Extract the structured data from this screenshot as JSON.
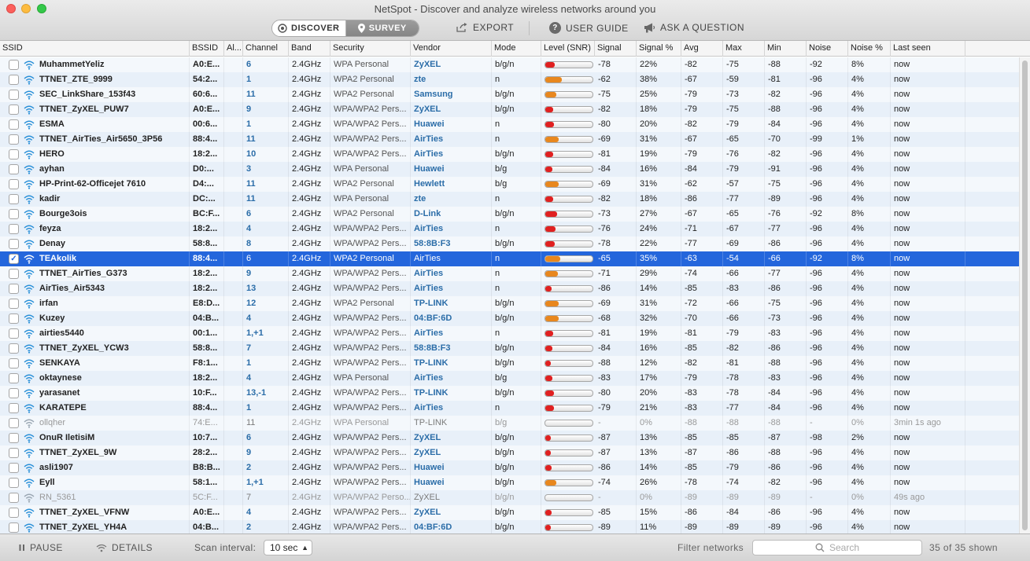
{
  "window": {
    "title": "NetSpot - Discover and analyze wireless networks around you"
  },
  "toolbar": {
    "discover_label": "DISCOVER",
    "survey_label": "SURVEY",
    "export_label": "EXPORT",
    "user_guide_label": "USER GUIDE",
    "ask_label": "ASK A QUESTION"
  },
  "columns": {
    "ssid": "SSID",
    "bssid": "BSSID",
    "alias": "Al...",
    "channel": "Channel",
    "band": "Band",
    "security": "Security",
    "vendor": "Vendor",
    "mode": "Mode",
    "level": "Level (SNR)",
    "signal": "Signal",
    "signal_pct": "Signal %",
    "avg": "Avg",
    "max": "Max",
    "min": "Min",
    "noise": "Noise",
    "noise_pct": "Noise %",
    "last_seen": "Last seen"
  },
  "colors": {
    "level_red": "#e02020",
    "level_orange": "#e8871e",
    "selection": "#2466dc",
    "link": "#2b6da8"
  },
  "rows": [
    {
      "ssid": "MuhammetYeliz",
      "bssid": "A0:E...",
      "channel": "6",
      "band": "2.4GHz",
      "security": "WPA Personal",
      "vendor": "ZyXEL",
      "mode": "b/g/n",
      "signal": "-78",
      "signal_pct": "22%",
      "level": 22,
      "level_color": "red",
      "avg": "-82",
      "max": "-75",
      "min": "-88",
      "noise": "-92",
      "noise_pct": "8%",
      "last_seen": "now"
    },
    {
      "ssid": "TTNET_ZTE_9999",
      "bssid": "54:2...",
      "channel": "1",
      "band": "2.4GHz",
      "security": "WPA2 Personal",
      "vendor": "zte",
      "mode": "n",
      "signal": "-62",
      "signal_pct": "38%",
      "level": 38,
      "level_color": "orange",
      "avg": "-67",
      "max": "-59",
      "min": "-81",
      "noise": "-96",
      "noise_pct": "4%",
      "last_seen": "now"
    },
    {
      "ssid": "SEC_LinkShare_153f43",
      "bssid": "60:6...",
      "channel": "11",
      "band": "2.4GHz",
      "security": "WPA2 Personal",
      "vendor": "Samsung",
      "mode": "b/g/n",
      "signal": "-75",
      "signal_pct": "25%",
      "level": 25,
      "level_color": "orange",
      "avg": "-79",
      "max": "-73",
      "min": "-82",
      "noise": "-96",
      "noise_pct": "4%",
      "last_seen": "now"
    },
    {
      "ssid": "TTNET_ZyXEL_PUW7",
      "bssid": "A0:E...",
      "channel": "9",
      "band": "2.4GHz",
      "security": "WPA/WPA2 Pers...",
      "vendor": "ZyXEL",
      "mode": "b/g/n",
      "signal": "-82",
      "signal_pct": "18%",
      "level": 18,
      "level_color": "red",
      "avg": "-79",
      "max": "-75",
      "min": "-88",
      "noise": "-96",
      "noise_pct": "4%",
      "last_seen": "now"
    },
    {
      "ssid": "ESMA",
      "bssid": "00:6...",
      "channel": "1",
      "band": "2.4GHz",
      "security": "WPA/WPA2 Pers...",
      "vendor": "Huawei",
      "mode": "n",
      "signal": "-80",
      "signal_pct": "20%",
      "level": 20,
      "level_color": "red",
      "avg": "-82",
      "max": "-79",
      "min": "-84",
      "noise": "-96",
      "noise_pct": "4%",
      "last_seen": "now"
    },
    {
      "ssid": "TTNET_AirTies_Air5650_3P56",
      "bssid": "88:4...",
      "channel": "11",
      "band": "2.4GHz",
      "security": "WPA/WPA2 Pers...",
      "vendor": "AirTies",
      "mode": "n",
      "signal": "-69",
      "signal_pct": "31%",
      "level": 31,
      "level_color": "orange",
      "avg": "-67",
      "max": "-65",
      "min": "-70",
      "noise": "-99",
      "noise_pct": "1%",
      "last_seen": "now"
    },
    {
      "ssid": "HERO",
      "bssid": "18:2...",
      "channel": "10",
      "band": "2.4GHz",
      "security": "WPA/WPA2 Pers...",
      "vendor": "AirTies",
      "mode": "b/g/n",
      "signal": "-81",
      "signal_pct": "19%",
      "level": 19,
      "level_color": "red",
      "avg": "-79",
      "max": "-76",
      "min": "-82",
      "noise": "-96",
      "noise_pct": "4%",
      "last_seen": "now"
    },
    {
      "ssid": "ayhan",
      "bssid": "D0:...",
      "channel": "3",
      "band": "2.4GHz",
      "security": "WPA Personal",
      "vendor": "Huawei",
      "mode": "b/g",
      "signal": "-84",
      "signal_pct": "16%",
      "level": 16,
      "level_color": "red",
      "avg": "-84",
      "max": "-79",
      "min": "-91",
      "noise": "-96",
      "noise_pct": "4%",
      "last_seen": "now"
    },
    {
      "ssid": "HP-Print-62-Officejet 7610",
      "bssid": "D4:...",
      "channel": "11",
      "band": "2.4GHz",
      "security": "WPA2 Personal",
      "vendor": "Hewlett",
      "mode": "b/g",
      "signal": "-69",
      "signal_pct": "31%",
      "level": 31,
      "level_color": "orange",
      "avg": "-62",
      "max": "-57",
      "min": "-75",
      "noise": "-96",
      "noise_pct": "4%",
      "last_seen": "now"
    },
    {
      "ssid": "kadir",
      "bssid": "DC:...",
      "channel": "11",
      "band": "2.4GHz",
      "security": "WPA Personal",
      "vendor": "zte",
      "mode": "n",
      "signal": "-82",
      "signal_pct": "18%",
      "level": 18,
      "level_color": "red",
      "avg": "-86",
      "max": "-77",
      "min": "-89",
      "noise": "-96",
      "noise_pct": "4%",
      "last_seen": "now"
    },
    {
      "ssid": "Bourge3ois",
      "bssid": "BC:F...",
      "channel": "6",
      "band": "2.4GHz",
      "security": "WPA2 Personal",
      "vendor": "D-Link",
      "mode": "b/g/n",
      "signal": "-73",
      "signal_pct": "27%",
      "level": 27,
      "level_color": "red",
      "avg": "-67",
      "max": "-65",
      "min": "-76",
      "noise": "-92",
      "noise_pct": "8%",
      "last_seen": "now"
    },
    {
      "ssid": "feyza",
      "bssid": "18:2...",
      "channel": "4",
      "band": "2.4GHz",
      "security": "WPA/WPA2 Pers...",
      "vendor": "AirTies",
      "mode": "n",
      "signal": "-76",
      "signal_pct": "24%",
      "level": 24,
      "level_color": "red",
      "avg": "-71",
      "max": "-67",
      "min": "-77",
      "noise": "-96",
      "noise_pct": "4%",
      "last_seen": "now"
    },
    {
      "ssid": "Denay",
      "bssid": "58:8...",
      "channel": "8",
      "band": "2.4GHz",
      "security": "WPA/WPA2 Pers...",
      "vendor": "58:8B:F3",
      "mode": "b/g/n",
      "signal": "-78",
      "signal_pct": "22%",
      "level": 22,
      "level_color": "red",
      "avg": "-77",
      "max": "-69",
      "min": "-86",
      "noise": "-96",
      "noise_pct": "4%",
      "last_seen": "now"
    },
    {
      "ssid": "TEAkolik",
      "bssid": "88:4...",
      "channel": "6",
      "band": "2.4GHz",
      "security": "WPA2 Personal",
      "vendor": "AirTies",
      "mode": "n",
      "signal": "-65",
      "signal_pct": "35%",
      "level": 35,
      "level_color": "orange",
      "avg": "-63",
      "max": "-54",
      "min": "-66",
      "noise": "-92",
      "noise_pct": "8%",
      "last_seen": "now",
      "selected": true
    },
    {
      "ssid": "TTNET_AirTies_G373",
      "bssid": "18:2...",
      "channel": "9",
      "band": "2.4GHz",
      "security": "WPA/WPA2 Pers...",
      "vendor": "AirTies",
      "mode": "n",
      "signal": "-71",
      "signal_pct": "29%",
      "level": 29,
      "level_color": "orange",
      "avg": "-74",
      "max": "-66",
      "min": "-77",
      "noise": "-96",
      "noise_pct": "4%",
      "last_seen": "now"
    },
    {
      "ssid": "AirTies_Air5343",
      "bssid": "18:2...",
      "channel": "13",
      "band": "2.4GHz",
      "security": "WPA/WPA2 Pers...",
      "vendor": "AirTies",
      "mode": "n",
      "signal": "-86",
      "signal_pct": "14%",
      "level": 14,
      "level_color": "red",
      "avg": "-85",
      "max": "-83",
      "min": "-86",
      "noise": "-96",
      "noise_pct": "4%",
      "last_seen": "now"
    },
    {
      "ssid": "irfan",
      "bssid": "E8:D...",
      "channel": "12",
      "band": "2.4GHz",
      "security": "WPA2 Personal",
      "vendor": "TP-LINK",
      "mode": "b/g/n",
      "signal": "-69",
      "signal_pct": "31%",
      "level": 31,
      "level_color": "orange",
      "avg": "-72",
      "max": "-66",
      "min": "-75",
      "noise": "-96",
      "noise_pct": "4%",
      "last_seen": "now"
    },
    {
      "ssid": "Kuzey",
      "bssid": "04:B...",
      "channel": "4",
      "band": "2.4GHz",
      "security": "WPA/WPA2 Pers...",
      "vendor": "04:BF:6D",
      "mode": "b/g/n",
      "signal": "-68",
      "signal_pct": "32%",
      "level": 32,
      "level_color": "orange",
      "avg": "-70",
      "max": "-66",
      "min": "-73",
      "noise": "-96",
      "noise_pct": "4%",
      "last_seen": "now"
    },
    {
      "ssid": "airties5440",
      "bssid": "00:1...",
      "channel": "1,+1",
      "band": "2.4GHz",
      "security": "WPA/WPA2 Pers...",
      "vendor": "AirTies",
      "mode": "n",
      "signal": "-81",
      "signal_pct": "19%",
      "level": 19,
      "level_color": "red",
      "avg": "-81",
      "max": "-79",
      "min": "-83",
      "noise": "-96",
      "noise_pct": "4%",
      "last_seen": "now"
    },
    {
      "ssid": "TTNET_ZyXEL_YCW3",
      "bssid": "58:8...",
      "channel": "7",
      "band": "2.4GHz",
      "security": "WPA/WPA2 Pers...",
      "vendor": "58:8B:F3",
      "mode": "b/g/n",
      "signal": "-84",
      "signal_pct": "16%",
      "level": 16,
      "level_color": "red",
      "avg": "-85",
      "max": "-82",
      "min": "-86",
      "noise": "-96",
      "noise_pct": "4%",
      "last_seen": "now"
    },
    {
      "ssid": "SENKAYA",
      "bssid": "F8:1...",
      "channel": "1",
      "band": "2.4GHz",
      "security": "WPA/WPA2 Pers...",
      "vendor": "TP-LINK",
      "mode": "b/g/n",
      "signal": "-88",
      "signal_pct": "12%",
      "level": 12,
      "level_color": "red",
      "avg": "-82",
      "max": "-81",
      "min": "-88",
      "noise": "-96",
      "noise_pct": "4%",
      "last_seen": "now"
    },
    {
      "ssid": "oktaynese",
      "bssid": "18:2...",
      "channel": "4",
      "band": "2.4GHz",
      "security": "WPA Personal",
      "vendor": "AirTies",
      "mode": "b/g",
      "signal": "-83",
      "signal_pct": "17%",
      "level": 17,
      "level_color": "red",
      "avg": "-79",
      "max": "-78",
      "min": "-83",
      "noise": "-96",
      "noise_pct": "4%",
      "last_seen": "now"
    },
    {
      "ssid": "yarasanet",
      "bssid": "10:F...",
      "channel": "13,-1",
      "band": "2.4GHz",
      "security": "WPA/WPA2 Pers...",
      "vendor": "TP-LINK",
      "mode": "b/g/n",
      "signal": "-80",
      "signal_pct": "20%",
      "level": 20,
      "level_color": "red",
      "avg": "-83",
      "max": "-78",
      "min": "-84",
      "noise": "-96",
      "noise_pct": "4%",
      "last_seen": "now"
    },
    {
      "ssid": "KARATEPE",
      "bssid": "88:4...",
      "channel": "1",
      "band": "2.4GHz",
      "security": "WPA/WPA2 Pers...",
      "vendor": "AirTies",
      "mode": "n",
      "signal": "-79",
      "signal_pct": "21%",
      "level": 21,
      "level_color": "red",
      "avg": "-83",
      "max": "-77",
      "min": "-84",
      "noise": "-96",
      "noise_pct": "4%",
      "last_seen": "now"
    },
    {
      "ssid": "ollqher",
      "bssid": "74:E...",
      "channel": "11",
      "band": "2.4GHz",
      "security": "WPA Personal",
      "vendor": "TP-LINK",
      "mode": "b/g",
      "signal": "-",
      "signal_pct": "0%",
      "level": 0,
      "level_color": "red",
      "avg": "-88",
      "max": "-88",
      "min": "-88",
      "noise": "-",
      "noise_pct": "0%",
      "last_seen": "3min 1s ago",
      "stale": true
    },
    {
      "ssid": "OnuR IletisiM",
      "bssid": "10:7...",
      "channel": "6",
      "band": "2.4GHz",
      "security": "WPA/WPA2 Pers...",
      "vendor": "ZyXEL",
      "mode": "b/g/n",
      "signal": "-87",
      "signal_pct": "13%",
      "level": 13,
      "level_color": "red",
      "avg": "-85",
      "max": "-85",
      "min": "-87",
      "noise": "-98",
      "noise_pct": "2%",
      "last_seen": "now"
    },
    {
      "ssid": "TTNET_ZyXEL_9W",
      "bssid": "28:2...",
      "channel": "9",
      "band": "2.4GHz",
      "security": "WPA/WPA2 Pers...",
      "vendor": "ZyXEL",
      "mode": "b/g/n",
      "signal": "-87",
      "signal_pct": "13%",
      "level": 13,
      "level_color": "red",
      "avg": "-87",
      "max": "-86",
      "min": "-88",
      "noise": "-96",
      "noise_pct": "4%",
      "last_seen": "now"
    },
    {
      "ssid": "asli1907",
      "bssid": "B8:B...",
      "channel": "2",
      "band": "2.4GHz",
      "security": "WPA/WPA2 Pers...",
      "vendor": "Huawei",
      "mode": "b/g/n",
      "signal": "-86",
      "signal_pct": "14%",
      "level": 14,
      "level_color": "red",
      "avg": "-85",
      "max": "-79",
      "min": "-86",
      "noise": "-96",
      "noise_pct": "4%",
      "last_seen": "now"
    },
    {
      "ssid": "Eyll",
      "bssid": "58:1...",
      "channel": "1,+1",
      "band": "2.4GHz",
      "security": "WPA/WPA2 Pers...",
      "vendor": "Huawei",
      "mode": "b/g/n",
      "signal": "-74",
      "signal_pct": "26%",
      "level": 26,
      "level_color": "orange",
      "avg": "-78",
      "max": "-74",
      "min": "-82",
      "noise": "-96",
      "noise_pct": "4%",
      "last_seen": "now"
    },
    {
      "ssid": "RN_5361",
      "bssid": "5C:F...",
      "channel": "7",
      "band": "2.4GHz",
      "security": "WPA/WPA2 Perso...",
      "vendor": "ZyXEL",
      "mode": "b/g/n",
      "signal": "-",
      "signal_pct": "0%",
      "level": 0,
      "level_color": "red",
      "avg": "-89",
      "max": "-89",
      "min": "-89",
      "noise": "-",
      "noise_pct": "0%",
      "last_seen": "49s ago",
      "stale": true
    },
    {
      "ssid": "TTNET_ZyXEL_VFNW",
      "bssid": "A0:E...",
      "channel": "4",
      "band": "2.4GHz",
      "security": "WPA/WPA2 Pers...",
      "vendor": "ZyXEL",
      "mode": "b/g/n",
      "signal": "-85",
      "signal_pct": "15%",
      "level": 15,
      "level_color": "red",
      "avg": "-86",
      "max": "-84",
      "min": "-86",
      "noise": "-96",
      "noise_pct": "4%",
      "last_seen": "now"
    },
    {
      "ssid": "TTNET_ZyXEL_YH4A",
      "bssid": "04:B...",
      "channel": "2",
      "band": "2.4GHz",
      "security": "WPA/WPA2 Pers...",
      "vendor": "04:BF:6D",
      "mode": "b/g/n",
      "signal": "-89",
      "signal_pct": "11%",
      "level": 11,
      "level_color": "red",
      "avg": "-89",
      "max": "-89",
      "min": "-89",
      "noise": "-96",
      "noise_pct": "4%",
      "last_seen": "now"
    }
  ],
  "footer": {
    "pause_label": "PAUSE",
    "details_label": "DETAILS",
    "scan_interval_label": "Scan interval:",
    "scan_interval_value": "10 sec",
    "filter_label": "Filter networks",
    "search_placeholder": "Search",
    "shown_count": "35 of 35 shown"
  }
}
